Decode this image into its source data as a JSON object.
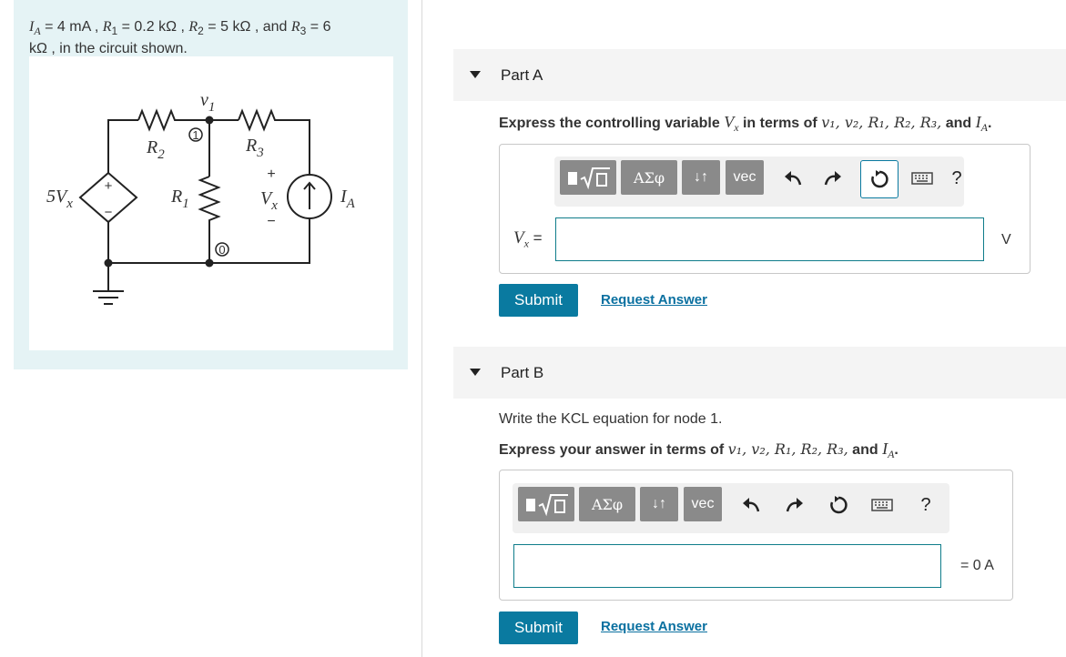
{
  "problem": {
    "text": "I_A = 4 mA , R1 = 0.2 kΩ , R2 = 5 kΩ , and R3 = 6 kΩ , in the circuit shown.",
    "ia_symbol": "I",
    "ia_sub": "A",
    "ia_value": " = 4 mA , ",
    "r1_symbol": "R",
    "r1_sub": "1",
    "r1_value": " = 0.2 kΩ , ",
    "r2_symbol": "R",
    "r2_sub": "2",
    "r2_value": " = 5 kΩ , and ",
    "r3_symbol": "R",
    "r3_sub": "3",
    "r3_value": " = 6",
    "line2": "kΩ , in the circuit shown."
  },
  "circuit": {
    "source_label": "5V",
    "source_sub": "x",
    "plus": "+",
    "minus": "−",
    "r1": "R",
    "r1_sub": "1",
    "r2": "R",
    "r2_sub": "2",
    "r3": "R",
    "r3_sub": "3",
    "v1": "v",
    "v1_sub": "1",
    "node1": "1",
    "node0": "0",
    "vx": "V",
    "vx_sub": "x",
    "ia": "I",
    "ia_sub": "A"
  },
  "part_a": {
    "title": "Part A",
    "prompt": "Express the controlling variable V_x in terms of v1, v2, R1, R2, R3, and I_A.",
    "prompt_lead": "Express the controlling variable ",
    "prompt_var": "V",
    "prompt_var_sub": "x",
    "prompt_mid": " in terms of ",
    "prompt_vars": "v₁, v₂, R₁, R₂, R₃,",
    "prompt_and": " and ",
    "prompt_last": "I",
    "prompt_last_sub": "A",
    "prompt_end": ".",
    "answer_label": "V",
    "answer_label_sub": "x",
    "answer_eq": " =",
    "answer_value": "",
    "unit": "V",
    "submit": "Submit",
    "request": "Request Answer"
  },
  "part_b": {
    "title": "Part B",
    "instruction": "Write the KCL equation for node 1.",
    "prompt": "Express your answer in terms of v1, v2, R1, R2, R3, and I_A.",
    "prompt_lead": "Express your answer in terms of ",
    "prompt_vars": "v₁, v₂, R₁, R₂, R₃,",
    "prompt_and": " and ",
    "prompt_last": "I",
    "prompt_last_sub": "A",
    "prompt_end": ".",
    "answer_value": "",
    "unit": "= 0 A",
    "submit": "Submit",
    "request": "Request Answer"
  },
  "toolbar": {
    "greek": "ΑΣφ",
    "arrows": "↓↑",
    "vec": "vec",
    "help": "?"
  }
}
